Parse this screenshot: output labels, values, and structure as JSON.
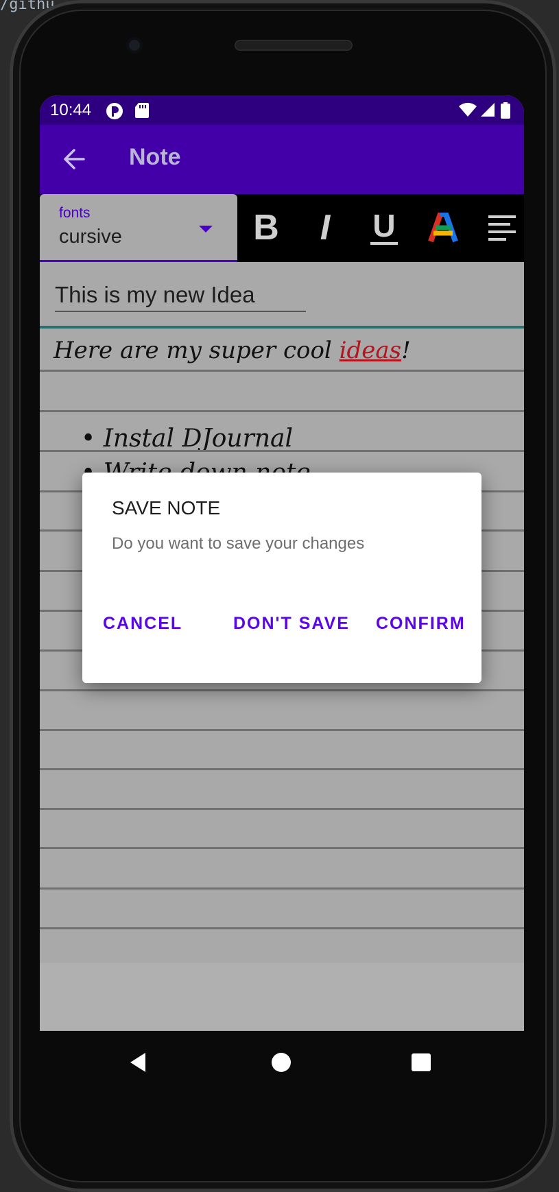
{
  "ide": {
    "frag_top": "/githu"
  },
  "status_bar": {
    "time": "10:44"
  },
  "app_bar": {
    "title": "Note"
  },
  "toolbar": {
    "fonts_label": "fonts",
    "fonts_value": "cursive",
    "bold_label": "B",
    "italic_label": "I",
    "underline_label": "U",
    "color_label": "A",
    "colors": {
      "accent": "#4400a8",
      "status": "#2e0080",
      "button_text": "#5b06e6"
    }
  },
  "note": {
    "title": "This is my new Idea",
    "line1_prefix": "Here are my super cool ",
    "line1_link": "ideas",
    "line1_suffix": "!",
    "bullets": [
      "Instal DJournal",
      "Write down note"
    ]
  },
  "dialog": {
    "title": "SAVE NOTE",
    "message": "Do you want to save your changes",
    "cancel": "CANCEL",
    "dont_save": "DON'T SAVE",
    "confirm": "CONFIRM"
  }
}
